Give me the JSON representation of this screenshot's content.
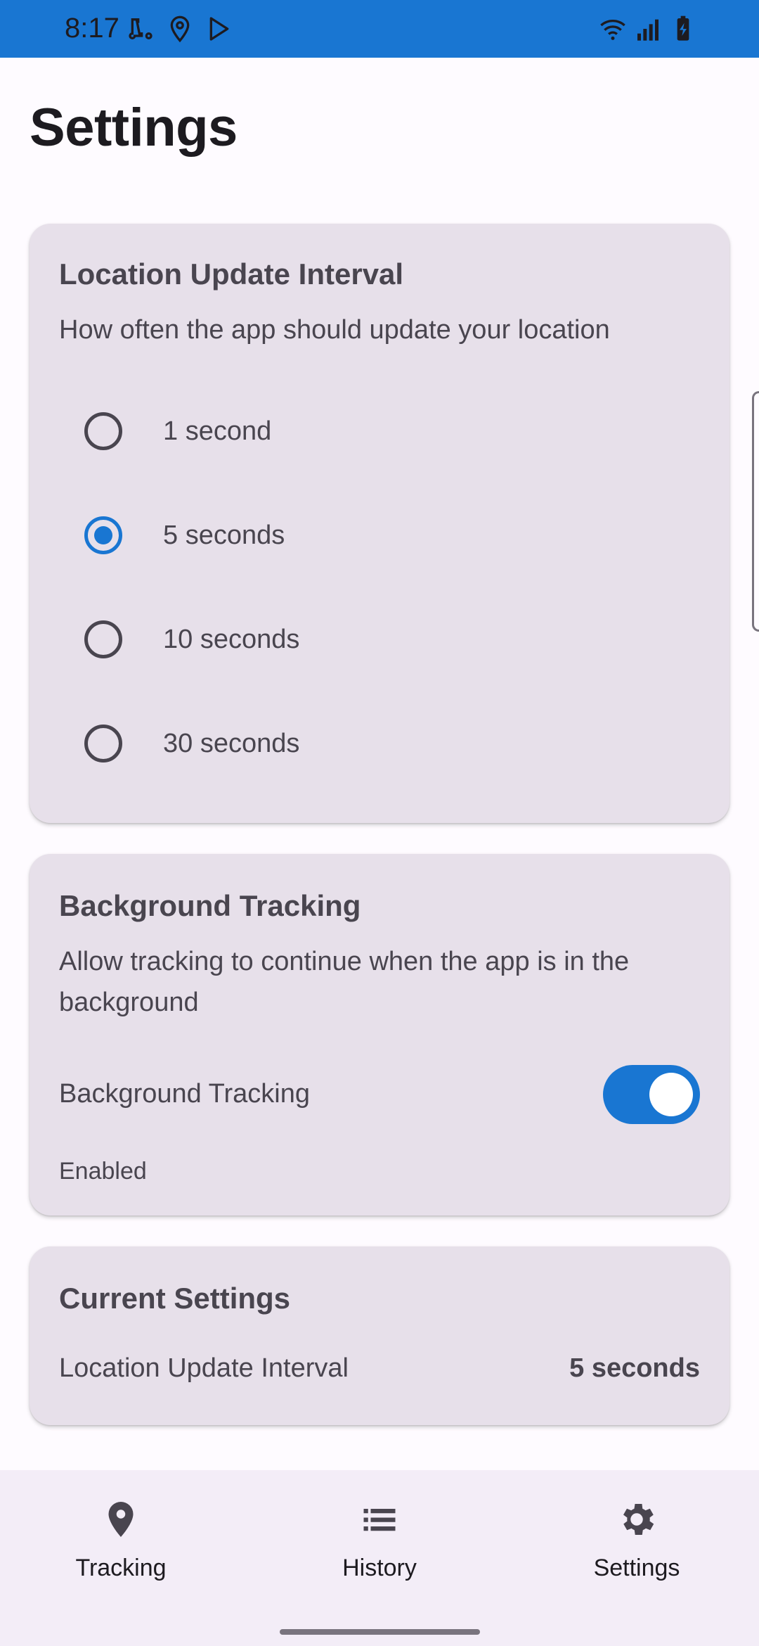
{
  "status_bar": {
    "time": "8:17",
    "left_icons": [
      "scooter-icon",
      "location-pin-icon",
      "play-store-icon"
    ],
    "right_icons": [
      "wifi-icon",
      "signal-icon",
      "battery-charging-icon"
    ],
    "color": "#1976d2"
  },
  "page": {
    "title": "Settings"
  },
  "interval_card": {
    "title": "Location Update Interval",
    "description": "How often the app should update your location",
    "options": [
      {
        "label": "1 second",
        "selected": false
      },
      {
        "label": "5 seconds",
        "selected": true
      },
      {
        "label": "10 seconds",
        "selected": false
      },
      {
        "label": "30 seconds",
        "selected": false
      }
    ]
  },
  "background_card": {
    "title": "Background Tracking",
    "description": "Allow tracking to continue when the app is in the background",
    "toggle_label": "Background Tracking",
    "toggle_on": true,
    "status_text": "Enabled"
  },
  "current_card": {
    "title": "Current Settings",
    "row_label": "Location Update Interval",
    "row_value": "5 seconds"
  },
  "bottom_nav": {
    "items": [
      {
        "label": "Tracking",
        "icon": "location-pin-icon"
      },
      {
        "label": "History",
        "icon": "list-icon"
      },
      {
        "label": "Settings",
        "icon": "gear-icon"
      }
    ]
  },
  "colors": {
    "accent": "#1976d2",
    "card": "#e7e0ea",
    "nav": "#f3edf7"
  }
}
